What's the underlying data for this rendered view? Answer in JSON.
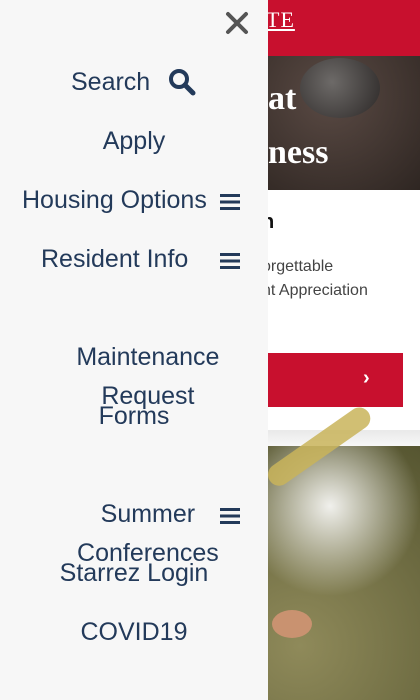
{
  "background": {
    "topbar_text": "TE",
    "hero_title": "at\nness",
    "card_title": "n",
    "card_text": "orgettable\nnt Appreciation",
    "card_button_chevron": "›"
  },
  "nav": {
    "close_icon": "close-icon",
    "items": [
      {
        "label": "Search"
      },
      {
        "label": "Apply"
      },
      {
        "label": "Housing Options"
      },
      {
        "label": "Resident Info"
      },
      {
        "label": "Maintenance\nRequest"
      },
      {
        "label": "Forms"
      },
      {
        "label": "Summer\nConferences"
      },
      {
        "label": "Starrez Login"
      },
      {
        "label": "COVID19"
      }
    ]
  },
  "colors": {
    "brand_red": "#c8102e",
    "nav_text": "#233a5a",
    "nav_bg": "#f7f7f7"
  }
}
